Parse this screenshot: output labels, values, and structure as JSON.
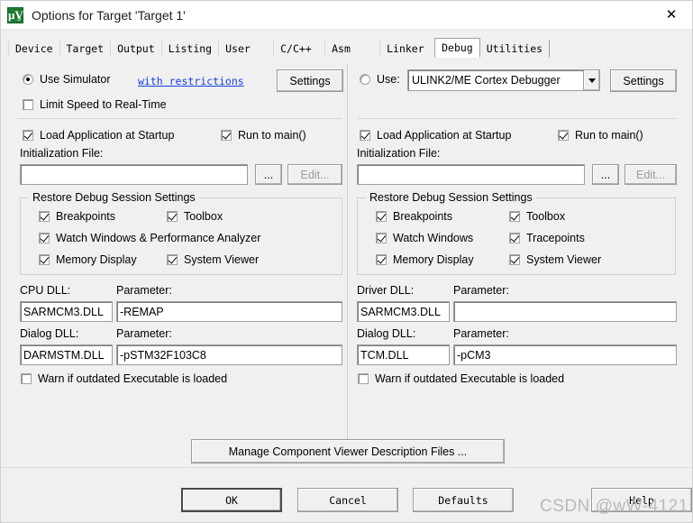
{
  "window": {
    "title": "Options for Target 'Target 1'",
    "icon": "uvision-icon",
    "close_label": "✕"
  },
  "tabs": [
    {
      "label": "Device",
      "selected": false
    },
    {
      "label": "Target",
      "selected": false
    },
    {
      "label": "Output",
      "selected": false
    },
    {
      "label": "Listing",
      "selected": false
    },
    {
      "label": "User",
      "selected": false
    },
    {
      "label": "C/C++",
      "selected": false
    },
    {
      "label": "Asm",
      "selected": false
    },
    {
      "label": "Linker",
      "selected": false
    },
    {
      "label": "Debug",
      "selected": true
    },
    {
      "label": "Utilities",
      "selected": false
    }
  ],
  "left": {
    "use_simulator_label": "Use Simulator",
    "use_simulator_checked": true,
    "restrictions_link": "with restrictions",
    "settings_label": "Settings",
    "limit_speed_label": "Limit Speed to Real-Time",
    "limit_speed_checked": false,
    "load_app_label": "Load Application at Startup",
    "load_app_checked": true,
    "run_to_main_label": "Run to main()",
    "run_to_main_checked": true,
    "init_file_label": "Initialization File:",
    "init_file_value": "",
    "browse_label": "...",
    "edit_label": "Edit...",
    "group_title": "Restore Debug Session Settings",
    "restore": [
      {
        "label": "Breakpoints",
        "checked": true
      },
      {
        "label": "Toolbox",
        "checked": true
      },
      {
        "label": "Watch Windows & Performance Analyzer",
        "checked": true
      },
      {
        "label": "Memory Display",
        "checked": true
      },
      {
        "label": "System Viewer",
        "checked": true
      }
    ],
    "cpu_dll_label": "CPU DLL:",
    "cpu_dll_value": "SARMCM3.DLL",
    "cpu_param_label": "Parameter:",
    "cpu_param_value": "-REMAP",
    "dialog_dll_label": "Dialog DLL:",
    "dialog_dll_value": "DARMSTM.DLL",
    "dialog_param_label": "Parameter:",
    "dialog_param_value": "-pSTM32F103C8",
    "warn_label": "Warn if outdated Executable is loaded",
    "warn_checked": false
  },
  "right": {
    "use_label": "Use:",
    "use_checked": false,
    "debugger_value": "ULINK2/ME Cortex Debugger",
    "settings_label": "Settings",
    "load_app_label": "Load Application at Startup",
    "load_app_checked": true,
    "run_to_main_label": "Run to main()",
    "run_to_main_checked": true,
    "init_file_label": "Initialization File:",
    "init_file_value": "",
    "browse_label": "...",
    "edit_label": "Edit...",
    "group_title": "Restore Debug Session Settings",
    "restore": [
      {
        "label": "Breakpoints",
        "checked": true
      },
      {
        "label": "Toolbox",
        "checked": true
      },
      {
        "label": "Watch Windows",
        "checked": true
      },
      {
        "label": "Tracepoints",
        "checked": true
      },
      {
        "label": "Memory Display",
        "checked": true
      },
      {
        "label": "System Viewer",
        "checked": true
      }
    ],
    "driver_dll_label": "Driver DLL:",
    "driver_dll_value": "SARMCM3.DLL",
    "driver_param_label": "Parameter:",
    "driver_param_value": "",
    "dialog_dll_label": "Dialog DLL:",
    "dialog_dll_value": "TCM.DLL",
    "dialog_param_label": "Parameter:",
    "dialog_param_value": "-pCM3",
    "warn_label": "Warn if outdated Executable is loaded",
    "warn_checked": false
  },
  "manage_button_label": "Manage Component Viewer Description Files ...",
  "footer": {
    "ok_label": "OK",
    "cancel_label": "Cancel",
    "defaults_label": "Defaults",
    "help_label": "Help"
  },
  "watermark": "CSDN @wW-4121",
  "colors": {
    "dialog_bg": "#f0f0f0",
    "link": "#1540d8",
    "field_bg": "#ffffff",
    "icon_green": "#1f7a33"
  }
}
